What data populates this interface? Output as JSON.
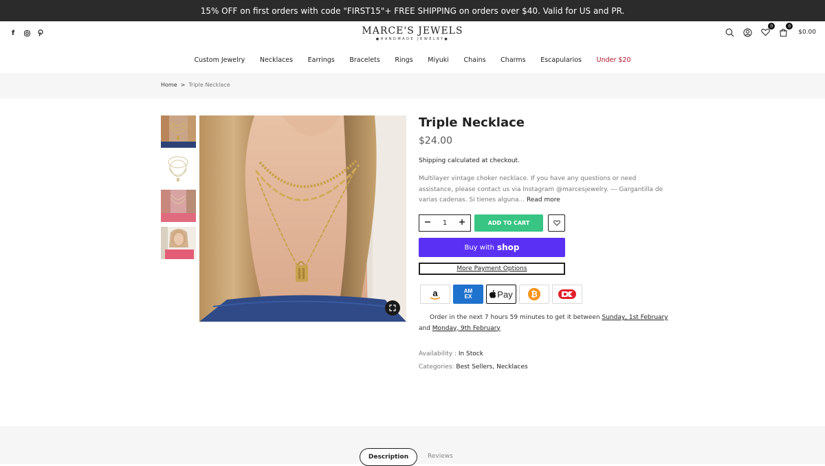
{
  "announcement": "15% OFF on first orders with code \"FIRST15\"+ FREE SHIPPING on orders over $40. Valid for US and PR.",
  "brand": {
    "name": "MARCE'S JEWELS",
    "tagline": "●HANDMADE JEWELRY●"
  },
  "header": {
    "wishlist_count": "0",
    "cart_count": "0",
    "cart_total": "$0.00"
  },
  "nav": [
    "Custom Jewelry",
    "Necklaces",
    "Earrings",
    "Bracelets",
    "Rings",
    "Miyuki",
    "Chains",
    "Charms",
    "Escapularios",
    "Under $20"
  ],
  "nav_sale_color": "#b0152c",
  "breadcrumb": {
    "home": "Home",
    "sep": ">",
    "current": "Triple Necklace"
  },
  "product": {
    "title": "Triple Necklace",
    "price": "$24.00",
    "shipping": "Shipping calculated at checkout.",
    "description": "Multilayer vintage choker necklace. If you have any questions or need assistance, please contact us via Instagram @marcesjewelry. --- Gargantilla de varias cadenas. Si tienes alguna... ",
    "read_more": "Read more",
    "quantity": "1",
    "add_to_cart": "ADD TO CART",
    "buy_with": "Buy with",
    "shop_word": "shop",
    "more_payment": "More Payment Options",
    "payments": [
      "amazon-pay",
      "amex",
      "apple-pay",
      "bitcoin",
      "dankort"
    ],
    "apple_pay_label": "Pay",
    "amex_label": "AM EX",
    "order_text_1": "Order in the next 7 hours 59 minutes to get it between ",
    "order_date_1": "Sunday, 1st February",
    "order_text_2": "and ",
    "order_date_2": "Monday, 9th February",
    "availability_label": "Availability : ",
    "availability_value": "In Stock",
    "categories_label": "Categories: ",
    "categories_value": "Best Sellers, Necklaces"
  },
  "tabs": [
    "Description",
    "Reviews"
  ],
  "colors": {
    "add_to_cart": "#38c584",
    "shop_pay": "#5a31f4",
    "topbar": "#2b2b2b"
  }
}
